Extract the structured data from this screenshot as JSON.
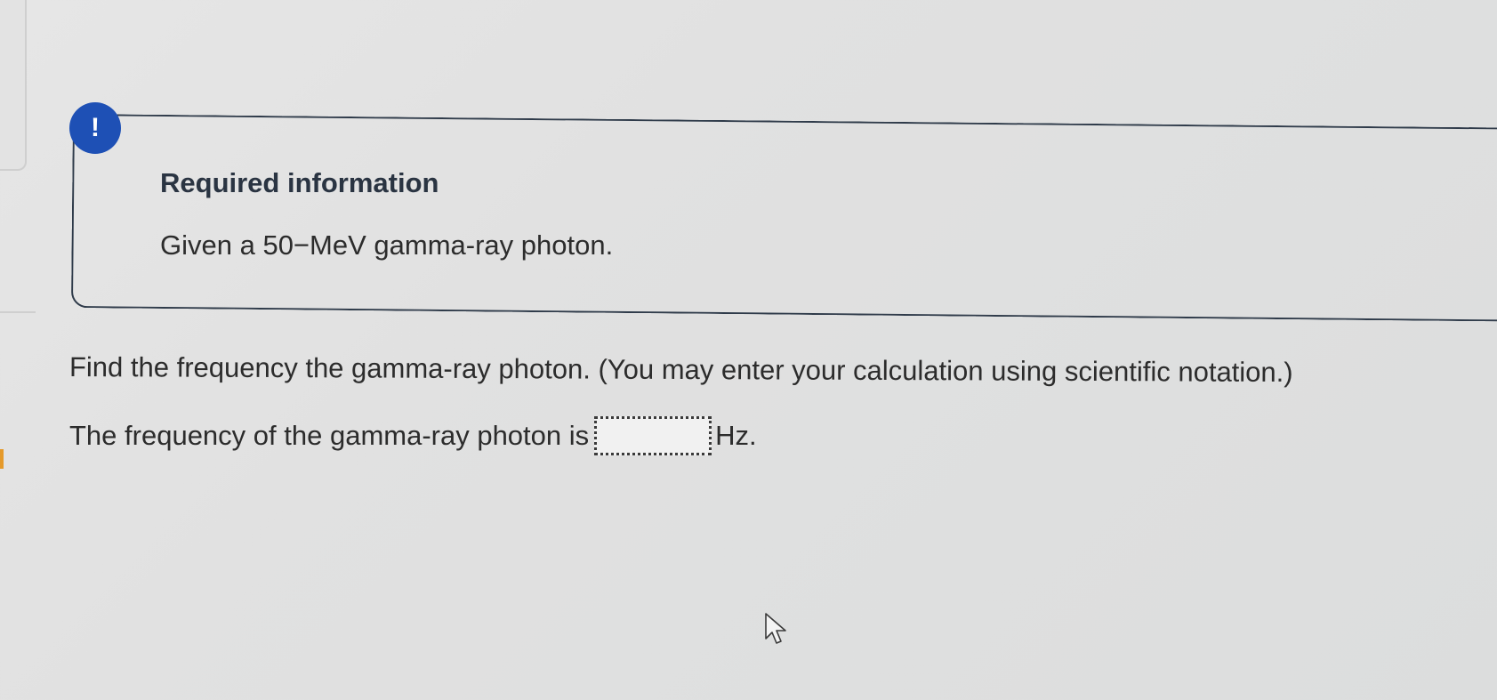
{
  "alert": {
    "symbol": "!"
  },
  "info_card": {
    "title": "Required information",
    "body": "Given a 50−MeV gamma-ray photon."
  },
  "question": {
    "prompt": "Find the frequency the gamma-ray photon. (You may enter your calculation using scientific notation.)",
    "answer_prefix": "The frequency of the gamma-ray photon is",
    "answer_value": "",
    "answer_placeholder": "",
    "answer_unit": "Hz."
  },
  "colors": {
    "accent": "#1e50b5",
    "card_border": "#2f3b4a",
    "background": "#e2e2e2"
  }
}
